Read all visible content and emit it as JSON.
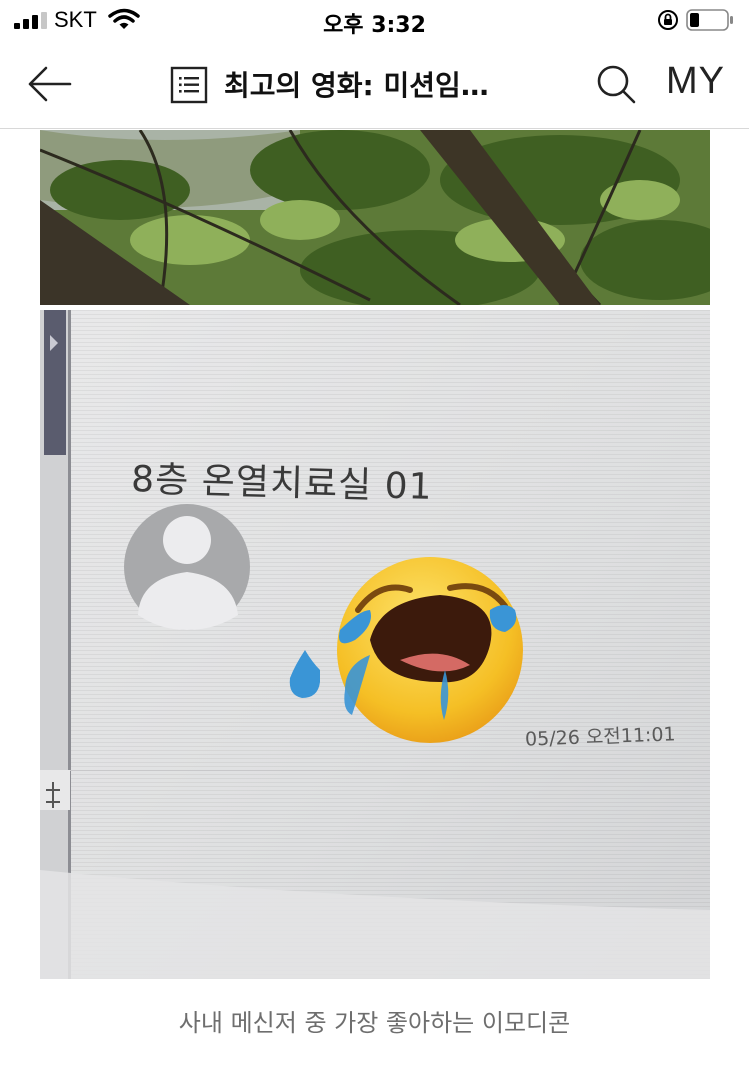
{
  "status_bar": {
    "carrier": "SKT",
    "time": "오후 3:32"
  },
  "nav": {
    "title": "최고의 영화: 미션임…",
    "my_label": "MY",
    "icons": [
      "back-arrow-icon",
      "list-icon",
      "search-icon"
    ]
  },
  "post": {
    "photo_messenger": {
      "sender_name": "8층 온열치료실 01",
      "timestamp": "05/26 오전11:01",
      "emoji": "loudly-crying-face"
    },
    "caption": "사내 메신저 중 가장 좋아하는 이모디콘"
  },
  "colors": {
    "emoji_yellow": "#f7c62e",
    "tear_blue": "#3a95d6",
    "foliage": "#4f6f2c"
  }
}
